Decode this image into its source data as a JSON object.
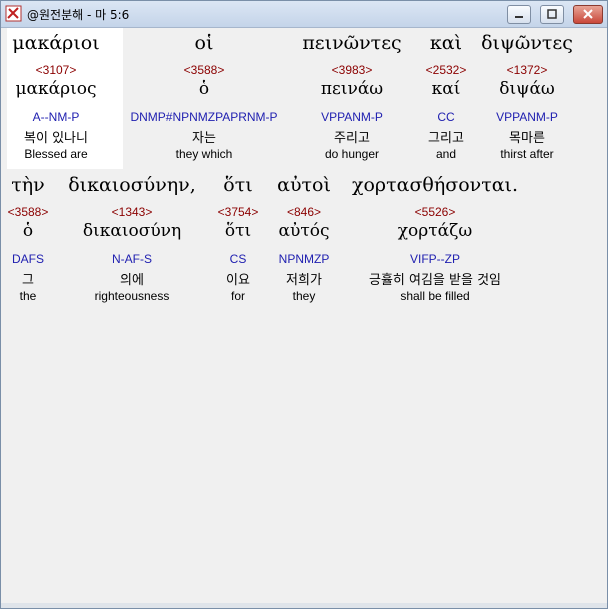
{
  "window": {
    "title": "@원전분해 - 마 5:6"
  },
  "rows": [
    [
      {
        "greek": "μακάριοι",
        "strong": "<3107>",
        "lemma": "μακάριος",
        "parse": "A--NM-P",
        "korean": "복이 있나니",
        "english": "Blessed are"
      },
      {
        "greek": "οἱ",
        "strong": "<3588>",
        "lemma": "ὁ",
        "parse": "DNMP#NPNMZPAPRNM-P",
        "korean": "자는",
        "english": "they which"
      },
      {
        "greek": "πεινῶντες",
        "strong": "<3983>",
        "lemma": "πεινάω",
        "parse": "VPPANM-P",
        "korean": "주리고",
        "english": "do hunger"
      },
      {
        "greek": "καὶ",
        "strong": "<2532>",
        "lemma": "καί",
        "parse": "CC",
        "korean": "그리고",
        "english": "and"
      },
      {
        "greek": "διψῶντες",
        "strong": "<1372>",
        "lemma": "διψάω",
        "parse": "VPPANM-P",
        "korean": "목마른",
        "english": "thirst after"
      }
    ],
    [
      {
        "greek": "τὴν",
        "strong": "<3588>",
        "lemma": "ὁ",
        "parse": "DAFS",
        "korean": "그",
        "english": "the"
      },
      {
        "greek": "δικαιοσύνην,",
        "strong": "<1343>",
        "lemma": "δικαιοσύνη",
        "parse": "N-AF-S",
        "korean": "의에",
        "english": "righteousness"
      },
      {
        "greek": "ὅτι",
        "strong": "<3754>",
        "lemma": "ὅτι",
        "parse": "CS",
        "korean": "이요",
        "english": "for"
      },
      {
        "greek": "αὐτοὶ",
        "strong": "<846>",
        "lemma": "αὐτός",
        "parse": "NPNMZP",
        "korean": "저희가",
        "english": "they"
      },
      {
        "greek": "χορτασθήσονται.",
        "strong": "<5526>",
        "lemma": "χορτάζω",
        "parse": "VIFP--ZP",
        "korean": "긍휼히 여김을 받을 것임",
        "english": "shall be filled"
      }
    ]
  ]
}
